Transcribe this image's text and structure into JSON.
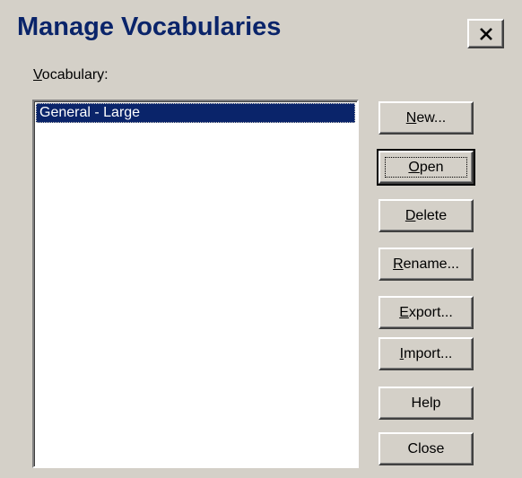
{
  "window": {
    "title": "Manage Vocabularies",
    "close_icon": "close-x-icon"
  },
  "vocabulary": {
    "label_mnemonic": "V",
    "label_rest": "ocabulary:",
    "items": [
      "General - Large"
    ],
    "selected_index": 0
  },
  "buttons": {
    "new": {
      "mnemonic": "N",
      "rest": "ew..."
    },
    "open": {
      "mnemonic": "O",
      "rest": "pen"
    },
    "delete": {
      "mnemonic": "D",
      "rest": "elete"
    },
    "rename": {
      "mnemonic": "R",
      "rest": "ename..."
    },
    "export": {
      "mnemonic": "E",
      "rest": "xport..."
    },
    "import": {
      "mnemonic": "I",
      "rest": "mport..."
    },
    "help": {
      "label": "Help"
    },
    "close": {
      "label": "Close"
    }
  },
  "colors": {
    "face": "#d4d0c8",
    "title_text": "#0a246a",
    "selection": "#0a246a"
  }
}
